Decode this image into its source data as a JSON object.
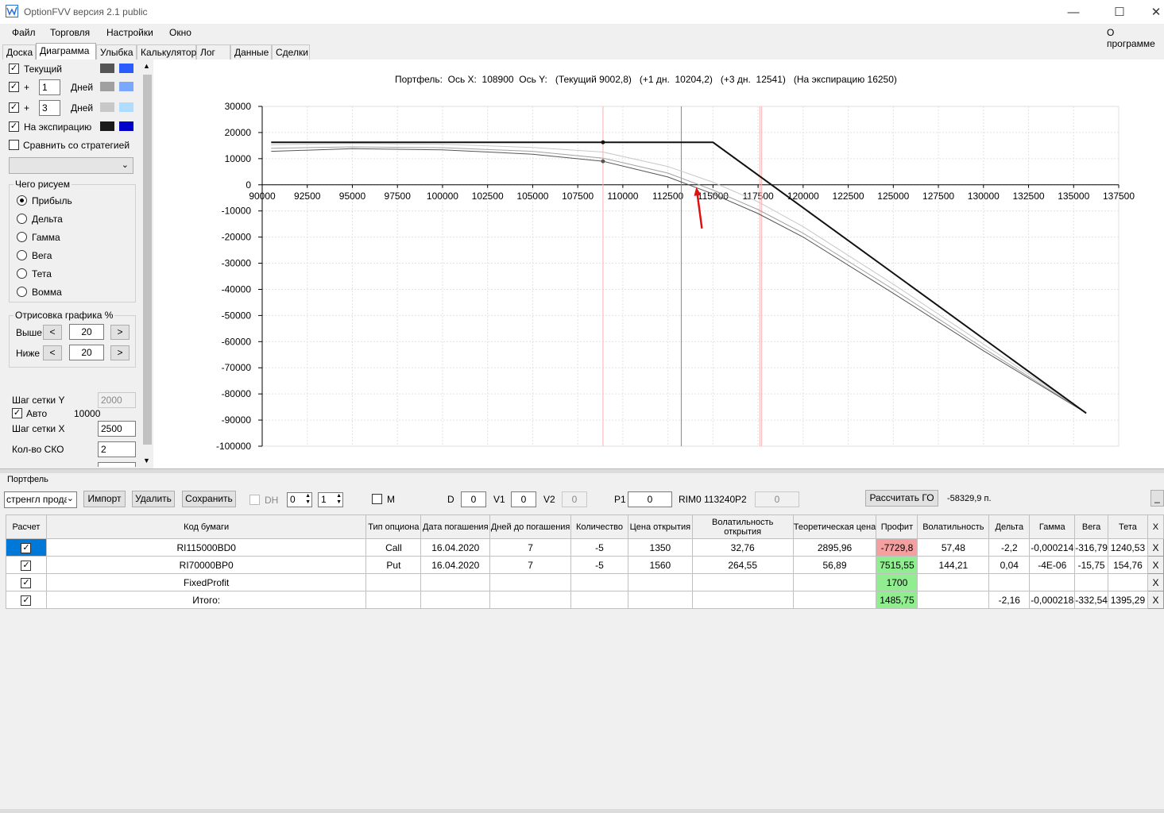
{
  "window": {
    "title": "OptionFVV версия 2.1 public"
  },
  "menu": {
    "file": "Файл",
    "trade": "Торговля",
    "settings": "Настройки",
    "window": "Окно",
    "about": "О программе"
  },
  "tabs": [
    "Доска",
    "Диаграмма",
    "Улыбка",
    "Калькулятор",
    "Лог",
    "Данные",
    "Сделки"
  ],
  "left": {
    "current": "Текущий",
    "plus": "+",
    "days1": "1",
    "days2": "3",
    "days_label": "Дней",
    "expiry": "На экспирацию",
    "compare": "Сравнить со стратегией",
    "what_title": "Чего рисуем",
    "radios": [
      "Прибыль",
      "Дельта",
      "Гамма",
      "Вега",
      "Тета",
      "Вомма"
    ],
    "draw_title": "Отрисовка графика %",
    "above": "Выше",
    "below": "Ниже",
    "above_val": "20",
    "below_val": "20",
    "lt": "<",
    "gt": ">",
    "grid_y": "Шаг сетки Y",
    "grid_y_val": "2000",
    "auto": "Авто",
    "auto_val": "10000",
    "grid_x": "Шаг сетки X",
    "grid_x_val": "2500",
    "sko": "Кол-во СКО",
    "sko_val": "2",
    "colors": {
      "current": [
        "#555555",
        "#2a5cff"
      ],
      "day1": [
        "#a0a0a0",
        "#7aa8ff"
      ],
      "day3": [
        "#c8c8c8",
        "#b0dcff"
      ],
      "expiry": [
        "#1a1a1a",
        "#0000cc"
      ]
    }
  },
  "chart_title": "Портфель:  Ось X:  108900  Ось Y:   (Текущий 9002,8)   (+1 дн.  10204,2)   (+3 дн.  12541)   (На экспирацию 16250)",
  "chart_data": {
    "type": "line",
    "xlim": [
      90000,
      137500
    ],
    "ylim": [
      -100000,
      30000
    ],
    "x_ticks": [
      90000,
      92500,
      95000,
      97500,
      100000,
      102500,
      105000,
      107500,
      110000,
      112500,
      115000,
      117500,
      120000,
      122500,
      125000,
      127500,
      130000,
      132500,
      135000,
      137500
    ],
    "y_ticks": [
      30000,
      20000,
      10000,
      0,
      -10000,
      -20000,
      -30000,
      -40000,
      -50000,
      -60000,
      -70000,
      -80000,
      -90000,
      -100000
    ],
    "grid": true,
    "vertical_lines": [
      {
        "x": 108900,
        "color": "#f4b4b4"
      },
      {
        "x": 113240,
        "color": "#888888"
      },
      {
        "x": 117600,
        "color": "#f4b4b4"
      },
      {
        "x": 117700,
        "color": "#f4b4b4"
      }
    ],
    "markers": [
      {
        "x": 108900,
        "y": 16250,
        "color": "#111111"
      },
      {
        "x": 108900,
        "y": 9003,
        "color": "#555555"
      }
    ],
    "series": [
      {
        "color": "#111111",
        "width": 2,
        "x": [
          90500,
          115000,
          135700
        ],
        "y": [
          16250,
          16250,
          -87400
        ]
      },
      {
        "color": "#c8c8c8",
        "width": 1,
        "x": [
          90500,
          95000,
          100000,
          105000,
          108900,
          112500,
          115000,
          117500,
          120000,
          125000,
          130000,
          135700
        ],
        "y": [
          15300,
          15800,
          15500,
          14300,
          12541,
          7000,
          1000,
          -6500,
          -16000,
          -38000,
          -61000,
          -87000
        ]
      },
      {
        "color": "#a0a0a0",
        "width": 1,
        "x": [
          90500,
          95000,
          100000,
          105000,
          108900,
          112500,
          115000,
          117500,
          120000,
          125000,
          130000,
          135700
        ],
        "y": [
          14000,
          14500,
          14200,
          12800,
          10204,
          4500,
          -2000,
          -9500,
          -18500,
          -40000,
          -62500,
          -87200
        ]
      },
      {
        "color": "#555555",
        "width": 1,
        "x": [
          90500,
          95000,
          100000,
          105000,
          108900,
          112500,
          115000,
          117500,
          120000,
          125000,
          130000,
          135700
        ],
        "y": [
          12800,
          13800,
          13400,
          11700,
          9003,
          3000,
          -3500,
          -11000,
          -20000,
          -41500,
          -63500,
          -87300
        ]
      }
    ]
  },
  "bottom": {
    "portfolio": "Портфель",
    "strategy": "стренгл прода",
    "import": "Импорт",
    "delete": "Удалить",
    "save": "Сохранить",
    "dh": "DH",
    "dh_v1": "0",
    "dh_v2": "1",
    "m": "M",
    "d": "D",
    "d_val": "0",
    "v1": "V1",
    "v1_val": "0",
    "v2": "V2",
    "v2_val": "0",
    "p1": "P1",
    "p1_val": "0",
    "rim": "RIM0 113240",
    "p2": "P2",
    "p2_val": "0",
    "calc_go": "Рассчитать ГО",
    "go_val": "-58329,9 п.",
    "min": "_"
  },
  "table": {
    "headers": [
      "Расчет",
      "Код бумаги",
      "Тип опциона",
      "Дата погашения",
      "Дней до погашения",
      "Количество",
      "Цена открытия",
      "Волатильность открытия",
      "Теоретическая цена",
      "Профит",
      "Волатильность",
      "Дельта",
      "Гамма",
      "Вега",
      "Тета",
      "X"
    ],
    "rows": [
      [
        "RI115000BD0",
        "Call",
        "16.04.2020",
        "7",
        "-5",
        "1350",
        "32,76",
        "2895,96",
        "-7729,8",
        "57,48",
        "-2,2",
        "-0,000214",
        "-316,79",
        "1240,53",
        "X"
      ],
      [
        "RI70000BP0",
        "Put",
        "16.04.2020",
        "7",
        "-5",
        "1560",
        "264,55",
        "56,89",
        "7515,55",
        "144,21",
        "0,04",
        "-4E-06",
        "-15,75",
        "154,76",
        "X"
      ],
      [
        "FixedProfit",
        "",
        "",
        "",
        "",
        "",
        "",
        "",
        "1700",
        "",
        "",
        "",
        "",
        "",
        "X"
      ],
      [
        "Итого:",
        "",
        "",
        "",
        "",
        "",
        "",
        "",
        "1485,75",
        "",
        "-2,16",
        "-0,000218",
        "-332,54",
        "1395,29",
        "X"
      ]
    ]
  }
}
